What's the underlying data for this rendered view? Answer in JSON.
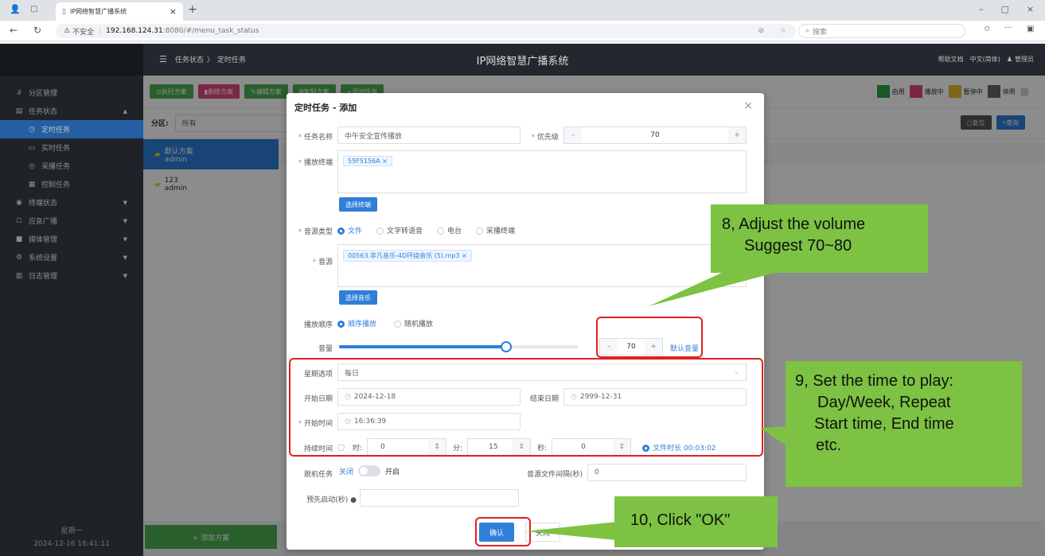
{
  "browser": {
    "tab_title": "IP网络智慧广播系统",
    "tab_close": "×",
    "new_tab": "+",
    "security_label": "不安全",
    "url_host": "192.168.124.31",
    "url_rest": ":8080/#/menu_task_status",
    "search_placeholder": "搜索",
    "more_label": "···"
  },
  "app": {
    "breadcrumb_parent": "任务状态",
    "breadcrumb_sep": "〉",
    "breadcrumb_current": "定时任务",
    "title": "IP网络智慧广播系统",
    "help": "帮助文档",
    "language": "中文(简体)",
    "user": "管理员"
  },
  "sidebar": {
    "items": [
      {
        "label": "分区管理",
        "icon": "link-icon"
      },
      {
        "label": "任务状态",
        "icon": "clipboard-icon"
      },
      {
        "label": "定时任务",
        "icon": "timer-icon"
      },
      {
        "label": "实时任务",
        "icon": "monitor-icon"
      },
      {
        "label": "采播任务",
        "icon": "record-icon"
      },
      {
        "label": "控制任务",
        "icon": "control-icon"
      },
      {
        "label": "终端状态",
        "icon": "terminal-icon"
      },
      {
        "label": "应急广播",
        "icon": "emergency-icon"
      },
      {
        "label": "媒体管理",
        "icon": "media-icon"
      },
      {
        "label": "系统设置",
        "icon": "settings-icon"
      },
      {
        "label": "日志管理",
        "icon": "log-icon"
      }
    ],
    "day": "星期一",
    "datetime": "2024-12-16 16:41:11"
  },
  "toolbar": {
    "execute": "执行方案",
    "delete": "删除方案",
    "edit": "编辑方案",
    "copy": "复制方案",
    "add_task": "添加任务",
    "legend": [
      {
        "label": "启用",
        "color": "#2ea043"
      },
      {
        "label": "播放中",
        "color": "#e0457b"
      },
      {
        "label": "暂停中",
        "color": "#e6b93a"
      },
      {
        "label": "停用",
        "color": "#666666"
      }
    ],
    "reset": "复位",
    "query": "查询"
  },
  "filter": {
    "label": "分区:",
    "value": "所有"
  },
  "plans": [
    {
      "name": "默认方案",
      "owner": "admin"
    },
    {
      "name": "123",
      "owner": "admin"
    }
  ],
  "add_plan": "+ 添加方案",
  "modal": {
    "title": "定时任务 - 添加",
    "close": "×",
    "task_name_label": "任务名称",
    "task_name": "中午安全宣传播放",
    "priority_label": "优先级",
    "priority": "70",
    "terminal_label": "播放终端",
    "terminal_tag": "55F5156A",
    "select_terminal": "选择终端",
    "source_type_label": "音源类型",
    "source_types": [
      "文件",
      "文字转语音",
      "电台",
      "采播终端"
    ],
    "source_label": "音源",
    "source_tag": "00563.非凡音乐-4D环绕音乐 (5).mp3",
    "select_music": "选择音乐",
    "order_label": "播放顺序",
    "orders": [
      "顺序播放",
      "随机播放"
    ],
    "volume_label": "音量",
    "volume": 70,
    "default_volume": "默认音量",
    "week_label": "星期选项",
    "week_value": "每日",
    "start_date_label": "开始日期",
    "start_date": "2024-12-18",
    "end_date_label": "结束日期",
    "end_date": "2999-12-31",
    "start_time_label": "开始时间",
    "start_time": "16:36:39",
    "duration_label": "持续时间",
    "hours_label": "时:",
    "hours": "0",
    "minutes_label": "分:",
    "minutes": "15",
    "seconds_label": "秒:",
    "seconds": "0",
    "file_duration": "文件时长 00:03:02",
    "offline_label": "脱机任务",
    "offline_off": "关闭",
    "offline_on": "开启",
    "interval_label": "音源文件间隔(秒)",
    "interval": "0",
    "prestart_label": "预先启动(秒)",
    "confirm": "确认",
    "cancel": "关闭"
  },
  "callouts": {
    "step8_line1": "8, Adjust the volume",
    "step8_line2": "Suggest 70~80",
    "step9_line1": "9, Set the time to play:",
    "step9_line2": "Day/Week, Repeat",
    "step9_line3": "Start time, End time",
    "step9_line4": "etc.",
    "step10": "10, Click \"OK\""
  }
}
